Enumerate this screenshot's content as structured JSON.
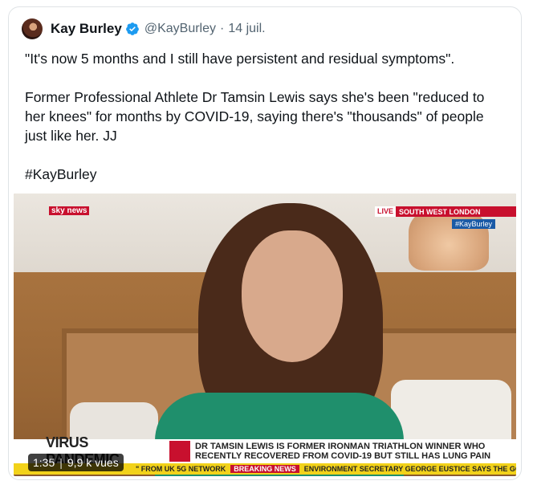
{
  "tweet": {
    "author_name": "Kay Burley",
    "author_handle": "@KayBurley",
    "separator": "·",
    "date": "14 juil.",
    "text_lines": [
      "\"It's now 5 months and I still have persistent and residual symptoms\".",
      "",
      "Former Professional Athlete Dr Tamsin Lewis says she's been \"reduced to",
      "her knees\" for months by COVID-19, saying there's \"thousands\" of people",
      "just like her. JJ",
      "",
      "#KayBurley"
    ]
  },
  "video": {
    "channel_logo": "sky news",
    "live_tag": "LIVE",
    "location": "SOUTH WEST LONDON",
    "hashtag": "#KayBurley",
    "topic": "VIRUS PANDEMIC",
    "headline_line1": "DR TAMSIN LEWIS IS FORMER IRONMAN TRIATHLON WINNER WHO",
    "headline_line2": "RECENTLY RECOVERED FROM COVID-19 BUT STILL HAS LUNG PAIN",
    "ticker_text": "\" FROM UK 5G NETWORK",
    "breaking_label": "BREAKING NEWS",
    "ticker_text2": "ENVIRONMENT SECRETARY GEORGE EUSTICE SAYS THE GOVERN",
    "duration": "1:35",
    "views": "9,9 k vues"
  },
  "colors": {
    "verified": "#1d9bf0",
    "sky_red": "#c8102e",
    "ticker_yellow": "#f2d21a"
  }
}
